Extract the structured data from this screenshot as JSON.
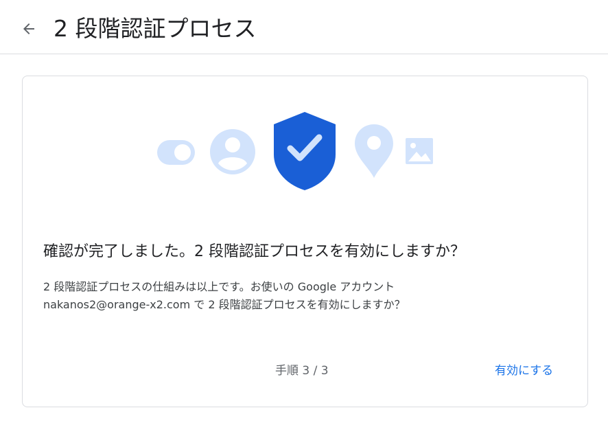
{
  "header": {
    "back_icon": "arrow-back-icon",
    "title": "2 段階認証プロセス"
  },
  "illustration": {
    "icons": [
      "toggle-icon",
      "account-circle-icon",
      "shield-check-icon",
      "location-pin-icon",
      "image-icon"
    ],
    "colors": {
      "light": "#d2e3fc",
      "shield": "#1a5fd6",
      "check": "#d2e3fc"
    }
  },
  "card": {
    "heading": "確認が完了しました。2 段階認証プロセスを有効にしますか？",
    "body_line1": "2 段階認証プロセスの仕組みは以上です。お使いの Google アカウント",
    "body_line2": "nakanos2@orange-x2.com で 2 段階認証プロセスを有効にしますか？",
    "step": "手順 3 / 3",
    "enable_button": "有効にする"
  },
  "colors": {
    "accent": "#1a73e8",
    "border": "#dadce0",
    "text": "#202124"
  }
}
